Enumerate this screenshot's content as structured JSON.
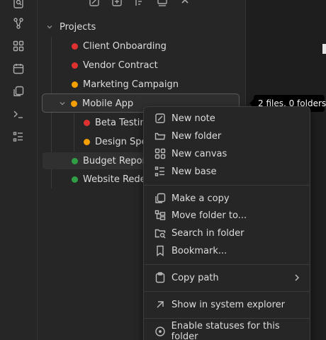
{
  "sidebar": {
    "root_label": "Projects",
    "items": [
      {
        "label": "Client Onboarding",
        "status": "#e03131"
      },
      {
        "label": "Vendor Contract",
        "status": "#e03131"
      },
      {
        "label": "Marketing Campaign",
        "status": "#f59f00"
      },
      {
        "label": "Mobile App",
        "status": "#f59f00"
      },
      {
        "label": "Beta Testing",
        "status": "#e03131"
      },
      {
        "label": "Design Specs",
        "status": "#f59f00"
      },
      {
        "label": "Budget Report",
        "status": "#2f9e44"
      },
      {
        "label": "Website Redesign",
        "status": "#2f9e44"
      }
    ]
  },
  "tooltip": "2 files, 0 folders",
  "menu": {
    "new_note": "New note",
    "new_folder": "New folder",
    "new_canvas": "New canvas",
    "new_base": "New base",
    "make_copy": "Make a copy",
    "move_folder": "Move folder to...",
    "search_folder": "Search in folder",
    "bookmark": "Bookmark...",
    "copy_path": "Copy path",
    "show_explorer": "Show in system explorer",
    "enable_statuses": "Enable statuses for this folder"
  }
}
